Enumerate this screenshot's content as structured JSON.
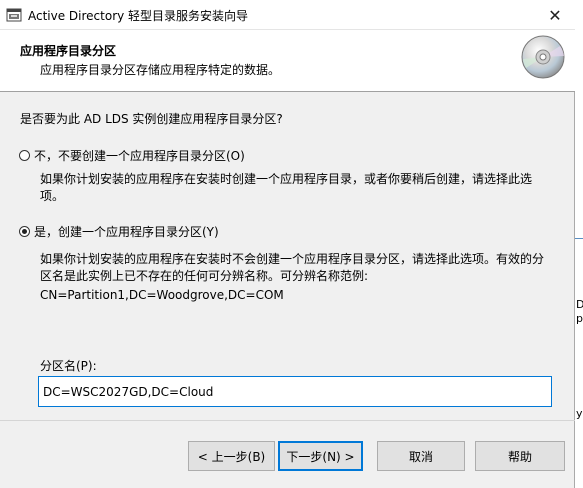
{
  "window": {
    "title": "Active Directory 轻型目录服务安装向导",
    "close_glyph": "✕"
  },
  "header": {
    "title": "应用程序目录分区",
    "subtitle": "应用程序目录分区存储应用程序特定的数据。"
  },
  "content": {
    "question": "是否要为此 AD LDS 实例创建应用程序目录分区?",
    "option_no": {
      "label": "不，不要创建一个应用程序目录分区(O)",
      "selected": false,
      "description": "如果你计划安装的应用程序在安装时创建一个应用程序目录，或者你要稍后创建，请选择此选项。"
    },
    "option_yes": {
      "label": "是，创建一个应用程序目录分区(Y)",
      "selected": true,
      "description": "如果你计划安装的应用程序在安装时不会创建一个应用程序目录分区，请选择此选项。有效的分区名是此实例上已不存在的任何可分辨名称。可分辨名称范例:",
      "example": "CN=Partition1,DC=Woodgrove,DC=COM"
    },
    "partition_name_label": "分区名(P):",
    "partition_name_value": "DC=WSC2027GD,DC=Cloud"
  },
  "buttons": {
    "back": "< 上一步(B)",
    "next": "下一步(N) >",
    "cancel": "取消",
    "help": "帮助"
  },
  "background_strip": {
    "fragments": [
      "D",
      "pl",
      "y"
    ]
  },
  "colors": {
    "accent": "#0078d7",
    "dialog_bg": "#f0f0f0",
    "button_bg": "#e1e1e1"
  }
}
